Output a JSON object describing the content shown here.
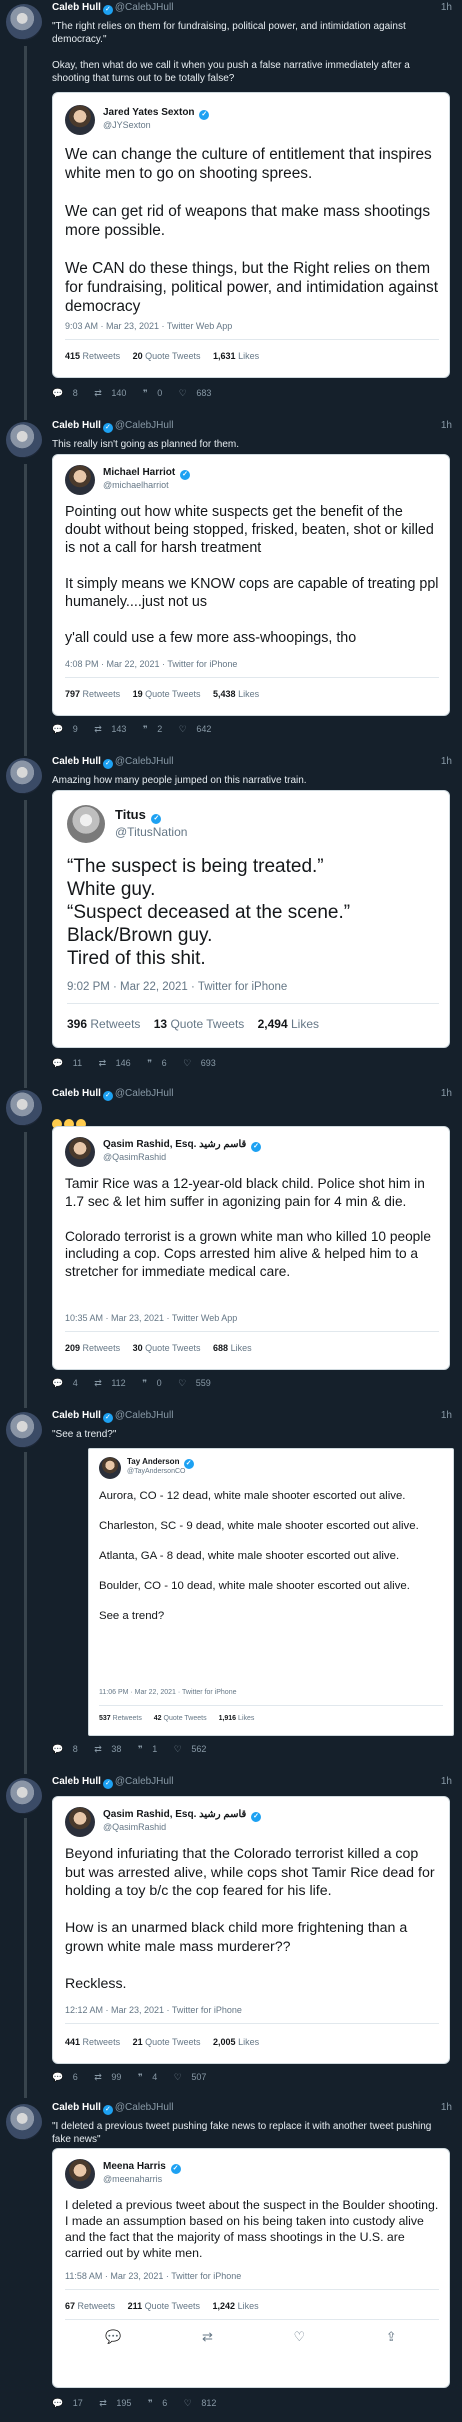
{
  "author": {
    "name": "Caleb Hull",
    "handle": "@CalebJHull",
    "time": "1h"
  },
  "tweets": [
    {
      "text": "\"The right relies on them for fundraising, political power, and intimidation against democracy.\"\n\nOkay, then what do we call it when you push a false narrative immediately after a shooting that turns out to be totally false?",
      "card": {
        "name": "Jared Yates Sexton",
        "handle": "@JYSexton",
        "text": "We can change the culture of entitlement that inspires white men to go on shooting sprees.\n\nWe can get rid of weapons that make mass shootings more possible.\n\nWe CAN do these things, but the Right relies on them for fundraising, political power, and intimidation against democracy",
        "meta": "9:03 AM · Mar 23, 2021 · Twitter Web App",
        "retweets": "415",
        "retweets_label": "Retweets",
        "quotes": "20",
        "quotes_label": "Quote Tweets",
        "likes": "1,631",
        "likes_label": "Likes"
      },
      "actions": {
        "replies": "8",
        "retweets": "140",
        "quotes": "0",
        "likes": "683"
      }
    },
    {
      "text": "This really isn't going as planned for them.",
      "card": {
        "name": "Michael Harriot",
        "handle": "@michaelharriot",
        "text": "Pointing out how white suspects get the benefit of the doubt without being stopped, frisked, beaten, shot or killed  is not a call for harsh treatment\n\nIt simply means we KNOW cops are capable of treating ppl humanely....just not us\n\ny'all could use a few more ass-whoopings, tho",
        "meta": "4:08 PM · Mar 22, 2021 · Twitter for iPhone",
        "retweets": "797",
        "retweets_label": "Retweets",
        "quotes": "19",
        "quotes_label": "Quote Tweets",
        "likes": "5,438",
        "likes_label": "Likes"
      },
      "actions": {
        "replies": "9",
        "retweets": "143",
        "quotes": "2",
        "likes": "642"
      }
    },
    {
      "text": "Amazing how many people jumped on this narrative train.",
      "card": {
        "name": "Titus",
        "handle": "@TitusNation",
        "text": "“The suspect is being treated.”\nWhite guy.\n“Suspect deceased at the scene.”\nBlack/Brown guy.\nTired of this shit.",
        "meta": "9:02 PM · Mar 22, 2021 · Twitter for iPhone",
        "retweets": "396",
        "retweets_label": "Retweets",
        "quotes": "13",
        "quotes_label": "Quote Tweets",
        "likes": "2,494",
        "likes_label": "Likes"
      },
      "actions": {
        "replies": "11",
        "retweets": "146",
        "quotes": "6",
        "likes": "693"
      }
    },
    {
      "text": "",
      "card": {
        "name": "Qasim Rashid, Esq. قاسم رشید",
        "handle": "@QasimRashid",
        "text": "Tamir Rice was a 12-year-old black child. Police shot him in 1.7 sec & let him suffer in agonizing pain for 4 min & die.\n\nColorado terrorist is a grown white man who killed 10 people including a cop. Cops arrested him alive & helped him to a stretcher for immediate medical care.",
        "meta": "10:35 AM · Mar 23, 2021 · Twitter Web App",
        "retweets": "209",
        "retweets_label": "Retweets",
        "quotes": "30",
        "quotes_label": "Quote Tweets",
        "likes": "688",
        "likes_label": "Likes"
      },
      "actions": {
        "replies": "4",
        "retweets": "112",
        "quotes": "0",
        "likes": "559"
      }
    },
    {
      "text": "\"See a trend?\"",
      "card": {
        "name": "Tay Anderson",
        "handle": "@TayAndersonCO",
        "text": "Aurora, CO - 12 dead, white male shooter escorted out alive.\n\nCharleston, SC - 9 dead, white male shooter escorted out alive.\n\nAtlanta, GA - 8 dead, white male shooter escorted out alive.\n\nBoulder, CO - 10 dead, white male shooter escorted out alive.\n\nSee a trend?",
        "meta": "11:06 PM · Mar 22, 2021 · Twitter for iPhone",
        "retweets": "537",
        "retweets_label": "Retweets",
        "quotes": "42",
        "quotes_label": "Quote Tweets",
        "likes": "1,916",
        "likes_label": "Likes"
      },
      "actions": {
        "replies": "8",
        "retweets": "38",
        "quotes": "1",
        "likes": "562"
      }
    },
    {
      "text": "",
      "card": {
        "name": "Qasim Rashid, Esq. قاسم رشید",
        "handle": "@QasimRashid",
        "text": "Beyond infuriating that the Colorado terrorist killed a cop but was arrested alive, while cops shot Tamir Rice dead for holding a toy b/c the cop feared for his life.\n\nHow is an unarmed black child more frightening than a grown white male mass murderer??\n\nReckless.",
        "meta": "12:12 AM · Mar 23, 2021 · Twitter for iPhone",
        "retweets": "441",
        "retweets_label": "Retweets",
        "quotes": "21",
        "quotes_label": "Quote Tweets",
        "likes": "2,005",
        "likes_label": "Likes"
      },
      "actions": {
        "replies": "6",
        "retweets": "99",
        "quotes": "4",
        "likes": "507"
      }
    },
    {
      "text": "\"I deleted a previous tweet pushing fake news to replace it with another tweet pushing fake news\"",
      "card": {
        "name": "Meena Harris",
        "handle": "@meenaharris",
        "text": "I deleted a previous tweet about the suspect in the Boulder shooting. I made an assumption based on his being taken into custody alive and the fact that the majority of mass shootings in the U.S. are carried out by white men.",
        "meta": "11:58 AM · Mar 23, 2021 · Twitter for iPhone",
        "retweets": "67",
        "retweets_label": "Retweets",
        "quotes": "211",
        "quotes_label": "Quote Tweets",
        "likes": "1,242",
        "likes_label": "Likes"
      },
      "actions": {
        "replies": "17",
        "retweets": "195",
        "quotes": "6",
        "likes": "812"
      }
    }
  ],
  "icons": {
    "reply": "reply-icon",
    "retweet": "retweet-icon",
    "like": "heart-icon",
    "share": "share-icon",
    "quote": "quote-icon"
  }
}
